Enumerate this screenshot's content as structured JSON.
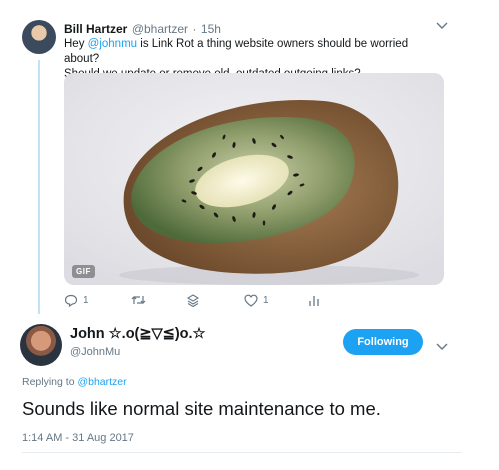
{
  "tweet": {
    "author_name": "Bill Hartzer",
    "author_handle": "@bhartzer",
    "separator": "·",
    "time": "15h",
    "text_prefix": "Hey ",
    "mention": "@johnmu",
    "text_line1_rest": " is Link Rot a thing website owners should be worried about?",
    "text_line2": "Should we update or remove old, outdated outgoing links?",
    "media_badge": "GIF",
    "reply_count": "1",
    "like_count": "1"
  },
  "reply": {
    "author_name": "John ☆.o(≧▽≦)o.☆",
    "author_handle": "@JohnMu",
    "follow_label": "Following",
    "replying_to_prefix": "Replying to",
    "replying_to_handle": "@bhartzer",
    "text": "Sounds like normal site maintenance to me.",
    "timestamp": "1:14 AM - 31 Aug 2017"
  },
  "colors": {
    "accent": "#1da1f2",
    "muted": "#657786",
    "text": "#14171a"
  },
  "icons": [
    "reply-icon",
    "retweet-icon",
    "dm-icon",
    "like-icon",
    "analytics-icon",
    "chevron-down-icon"
  ]
}
